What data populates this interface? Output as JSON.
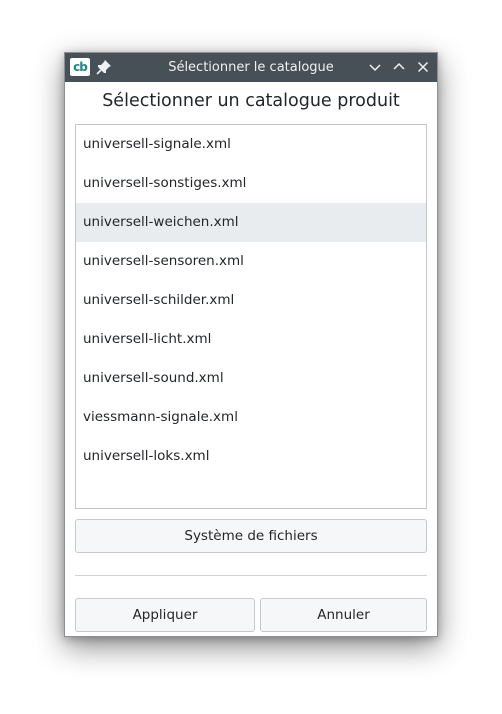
{
  "window": {
    "title": "Sélectionner le catalogue",
    "app_icon_text": "cb",
    "icons": [
      "app-icon",
      "pin-icon",
      "minimize-icon",
      "maximize-icon",
      "close-icon"
    ]
  },
  "dialog": {
    "heading": "Sélectionner un catalogue produit",
    "items": [
      {
        "label": "universell-signale.xml"
      },
      {
        "label": "universell-sonstiges.xml"
      },
      {
        "label": "universell-weichen.xml"
      },
      {
        "label": "universell-sensoren.xml"
      },
      {
        "label": "universell-schilder.xml"
      },
      {
        "label": "universell-licht.xml"
      },
      {
        "label": "universell-sound.xml"
      },
      {
        "label": "viessmann-signale.xml"
      },
      {
        "label": "universell-loks.xml"
      }
    ],
    "selected_item": "universell-weichen.xml",
    "filesystem_button": "Système de fichiers",
    "apply_button": "Appliquer",
    "cancel_button": "Annuler"
  },
  "colors": {
    "titlebar": "#475057",
    "titlebar_text": "#eef1f3",
    "app_icon_accent": "#1e8a84",
    "selected_row": "#e9ecef",
    "text": "#232629"
  }
}
